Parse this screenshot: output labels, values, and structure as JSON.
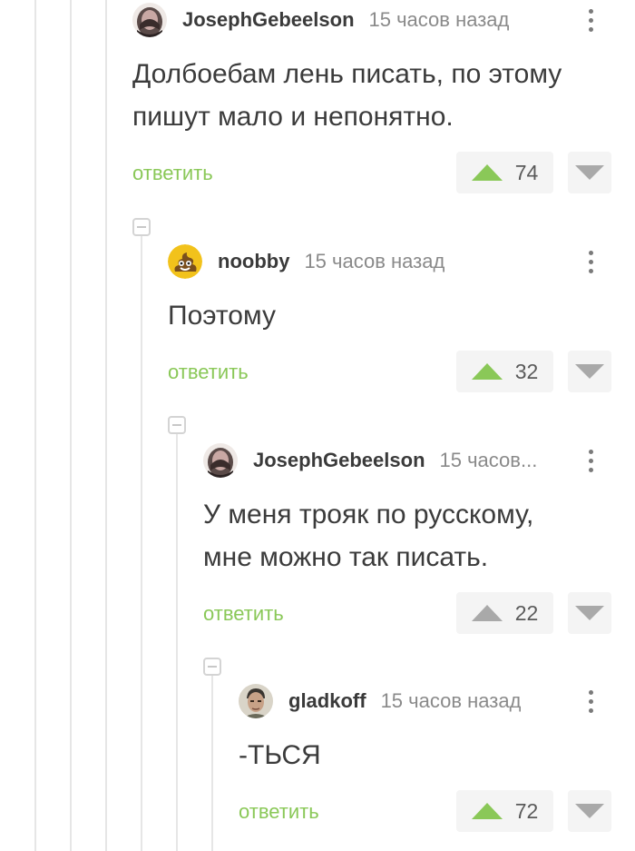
{
  "colors": {
    "reply_link": "#8ac858",
    "upvote_active": "#8ac858",
    "upvote_neutral": "#a9a9a9",
    "downvote": "#a9a9a9",
    "author_text": "#3a3a3a",
    "time_text": "#8a8a8a",
    "thread_line": "#e6e6e6"
  },
  "comments": [
    {
      "author": "JosephGebeelson",
      "time": "15 часов назад",
      "avatar_icon": "man-portrait-avatar",
      "text_lines": [
        "Долбоебам лень писать, по этому",
        "пишут мало и непонятно."
      ],
      "reply_label": "ответить",
      "votes": "74",
      "upvoted": true
    },
    {
      "author": "noobby",
      "time": "15 часов назад",
      "avatar_icon": "poop-emoji-avatar",
      "text_lines": [
        "Поэтому"
      ],
      "reply_label": "ответить",
      "votes": "32",
      "upvoted": true
    },
    {
      "author": "JosephGebeelson",
      "time": "15 часов...",
      "avatar_icon": "man-portrait-avatar",
      "text_lines": [
        "У меня трояк по русскому,",
        "мне можно так писать."
      ],
      "reply_label": "ответить",
      "votes": "22",
      "upvoted": false
    },
    {
      "author": "gladkoff",
      "time": "15 часов назад",
      "avatar_icon": "man-face-avatar",
      "text_lines": [
        "-ТЬСЯ"
      ],
      "reply_label": "ответить",
      "votes": "72",
      "upvoted": true
    }
  ]
}
